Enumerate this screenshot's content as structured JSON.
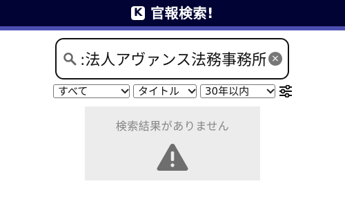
{
  "header": {
    "logo_letter": "K",
    "title": "官報検索!",
    "bg_color": "#000333",
    "accent_color": "#4c4fb2"
  },
  "search": {
    "value": ":法人アヴァンス法務事務所",
    "icon": "search-icon",
    "clear_icon": "clear-icon"
  },
  "filters": {
    "category": {
      "selected": "すべて"
    },
    "field": {
      "selected": "タイトル"
    },
    "period": {
      "selected": "30年以内"
    },
    "settings_icon": "sliders-icon"
  },
  "results": {
    "message": "検索結果がありません",
    "icon": "warning-icon",
    "panel_color": "#ececec"
  }
}
